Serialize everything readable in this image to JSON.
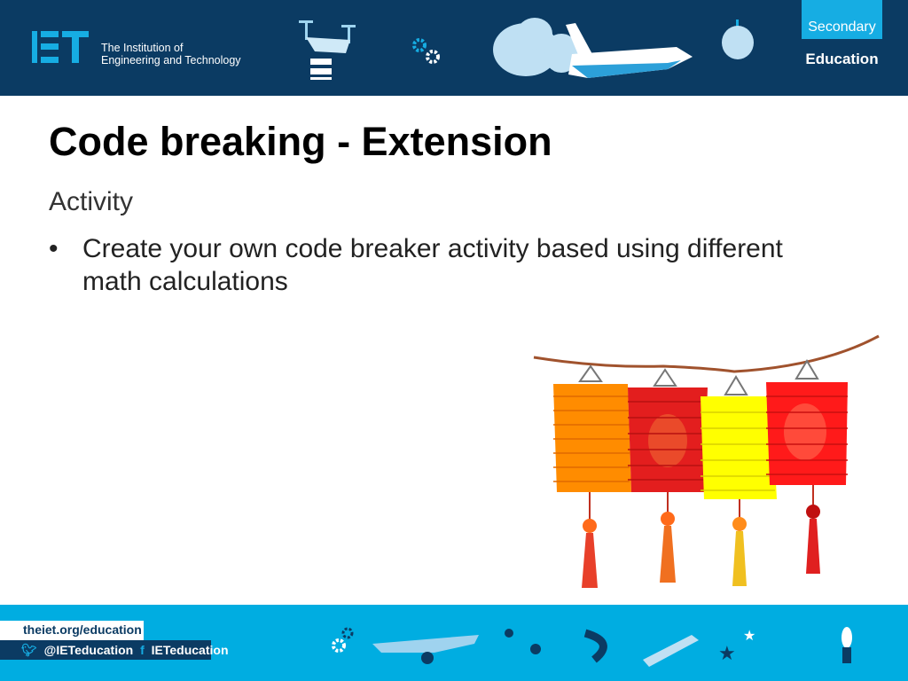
{
  "header": {
    "logo_letters": "IET",
    "org_line1": "The Institution of",
    "org_line2": "Engineering and Technology",
    "badge_top": "Secondary",
    "badge_bottom": "Education",
    "colors": {
      "navy": "#0b3b63",
      "light_blue": "#16ade3"
    },
    "icons": [
      "drone-icon",
      "gears-icon",
      "cloud-icon",
      "space-shuttle-icon",
      "apple-icon"
    ]
  },
  "slide": {
    "title": "Code breaking - Extension",
    "subtitle": "Activity",
    "bullets": [
      {
        "marker": "•",
        "text": "Create your own code breaker activity based using different math calculations"
      }
    ],
    "image": "chinese-lanterns"
  },
  "footer": {
    "url": "theiet.org/education",
    "twitter": "@IETeducation",
    "facebook": "IETeducation",
    "colors": {
      "bar": "#00ade1"
    },
    "icons": [
      "gears-icon",
      "plane-icon",
      "location-pin-icon",
      "magnet-icon",
      "pencil-icon",
      "stars-icon",
      "lightbulb-icon"
    ]
  }
}
